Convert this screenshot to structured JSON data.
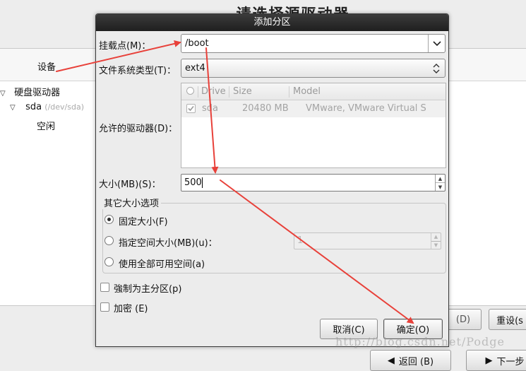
{
  "background": {
    "title": "请选择源驱动器",
    "column_device": "设备",
    "tree": {
      "root_label": "硬盘驱动器",
      "disk_label": "sda",
      "disk_path": "(/dev/sda)",
      "free_label": "空闲"
    },
    "buttons": {
      "delete_label": "(D)",
      "reset_label": "重设(s",
      "back_label": "返回 (B)",
      "next_label": "下一步"
    }
  },
  "dialog": {
    "title": "添加分区",
    "mount_point": {
      "label": "挂载点(M)：",
      "value": "/boot"
    },
    "fs_type": {
      "label": "文件系统类型(T)：",
      "value": "ext4"
    },
    "drives": {
      "label": "允许的驱动器(D)：",
      "columns": [
        "Drive",
        "Size",
        "Model"
      ],
      "rows": [
        {
          "checked": true,
          "drive": "sda",
          "size": "20480 MB",
          "model": "VMware, VMware Virtual S"
        }
      ]
    },
    "size": {
      "label": "大小(MB)(S)：",
      "value": "500"
    },
    "other_options": {
      "legend": "其它大小选项",
      "fixed": "固定大小(F)",
      "up_to": "指定空间大小(MB)(u)：",
      "up_to_value": "1",
      "fill_all": "使用全部可用空间(a)",
      "selected": "fixed"
    },
    "force_primary": "強制为主分区(p)",
    "encrypt": "加密 (E)",
    "cancel_label": "取消(C)",
    "ok_label": "确定(O)"
  },
  "annotation": {
    "arrow_color": "#e8413a",
    "watermark": "http://blog.csdn.net/Podge"
  }
}
